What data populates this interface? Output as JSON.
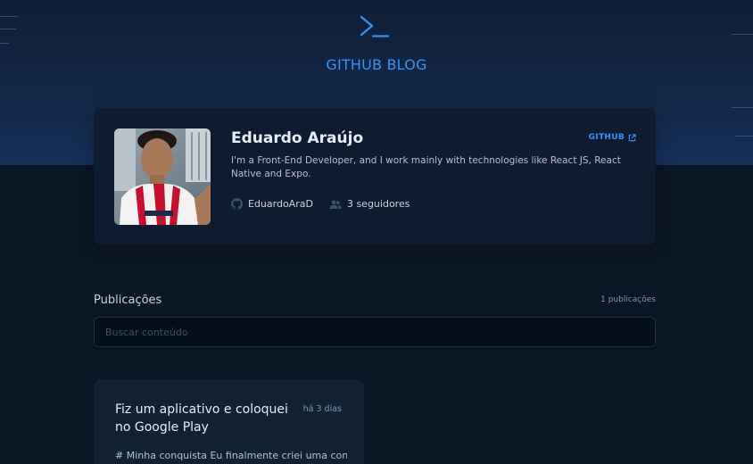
{
  "header": {
    "logo_icon": "terminal-prompt-icon",
    "title": "GITHUB BLOG",
    "accent_color": "#3294f8"
  },
  "profile": {
    "name": "Eduardo Araújo",
    "github_link_label": "GITHUB",
    "github_link_icon": "external-link-icon",
    "bio": "I'm a Front-End Developer, and I work mainly with technologies like React JS, React Native and Expo.",
    "username": "EduardoAraD",
    "username_icon": "github-icon",
    "followers": "3 seguidores",
    "followers_icon": "users-icon",
    "avatar_icon": "avatar-photo"
  },
  "publications": {
    "label": "Publicações",
    "count": "1 publicações",
    "search_placeholder": "Buscar conteúdo",
    "search_value": ""
  },
  "posts": [
    {
      "title": "Fiz um aplicativo e coloquei no Google Play",
      "date": "há 3 dias",
      "excerpt": "# Minha conquista Eu finalmente criei uma conta"
    }
  ]
}
